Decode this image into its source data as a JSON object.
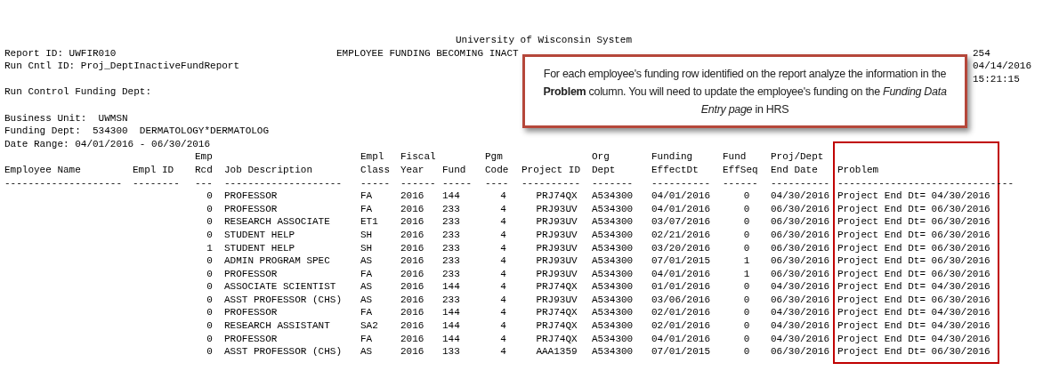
{
  "header": {
    "university": "University of Wisconsin System",
    "report_id": "Report ID: UWFIR010",
    "report_title": "EMPLOYEE FUNDING BECOMING INACT",
    "page_no": "254",
    "run_cntl_id": "Run Cntl ID: Proj_DeptInactiveFundReport",
    "run_date": "04/14/2016",
    "run_time": "15:21:15",
    "run_control_funding_dept": "Run Control Funding Dept:",
    "business_unit": "Business Unit:  UWMSN",
    "funding_dept": "Funding Dept:  534300  DERMATOLOGY*DERMATOLOG",
    "date_range": "Date Range: 04/01/2016 - 06/30/2016"
  },
  "callout": {
    "text": "For each employee's funding row identified on the report analyze the information in the **Problem** column. You will need to update the employee's funding on the *Funding Data Entry page* in HRS"
  },
  "table": {
    "columns": [
      {
        "header": [
          "Employee Name"
        ],
        "rule": "--------------------",
        "highlighted": false
      },
      {
        "header": [
          "Empl ID"
        ],
        "rule": "--------",
        "highlighted": false
      },
      {
        "header": [
          "Emp",
          "Rcd"
        ],
        "rule": "---",
        "highlighted": false
      },
      {
        "header": [
          "Job Description"
        ],
        "rule": "--------------------",
        "highlighted": false
      },
      {
        "header": [
          "Empl",
          "Class"
        ],
        "rule": "-----",
        "highlighted": false
      },
      {
        "header": [
          "Fiscal",
          "Year"
        ],
        "rule": "------",
        "highlighted": false
      },
      {
        "header": [
          "Fund"
        ],
        "rule": "-----",
        "highlighted": false
      },
      {
        "header": [
          "Pgm",
          "Code"
        ],
        "rule": "----",
        "highlighted": false
      },
      {
        "header": [
          "Project ID"
        ],
        "rule": "----------",
        "highlighted": false
      },
      {
        "header": [
          "Org",
          "Dept"
        ],
        "rule": "-------",
        "highlighted": false
      },
      {
        "header": [
          "Funding",
          "EffectDt"
        ],
        "rule": "----------",
        "highlighted": false
      },
      {
        "header": [
          "Fund",
          "EffSeq"
        ],
        "rule": "------",
        "highlighted": false
      },
      {
        "header": [
          "Proj/Dept",
          "End Date"
        ],
        "rule": "----------",
        "highlighted": false
      },
      {
        "header": [
          "Problem"
        ],
        "rule": "------------------------------",
        "highlighted": true
      }
    ],
    "rows": [
      [
        "",
        "",
        "0",
        "PROFESSOR",
        "FA",
        "2016",
        "144",
        "4",
        "PRJ74QX",
        "A534300",
        "04/01/2016",
        "0",
        "04/30/2016",
        "Project End Dt= 04/30/2016"
      ],
      [
        "",
        "",
        "0",
        "PROFESSOR",
        "FA",
        "2016",
        "233",
        "4",
        "PRJ93UV",
        "A534300",
        "04/01/2016",
        "0",
        "06/30/2016",
        "Project End Dt= 06/30/2016"
      ],
      [
        "",
        "",
        "0",
        "RESEARCH ASSOCIATE",
        "ET1",
        "2016",
        "233",
        "4",
        "PRJ93UV",
        "A534300",
        "03/07/2016",
        "0",
        "06/30/2016",
        "Project End Dt= 06/30/2016"
      ],
      [
        "",
        "",
        "0",
        "STUDENT HELP",
        "SH",
        "2016",
        "233",
        "4",
        "PRJ93UV",
        "A534300",
        "02/21/2016",
        "0",
        "06/30/2016",
        "Project End Dt= 06/30/2016"
      ],
      [
        "",
        "",
        "1",
        "STUDENT HELP",
        "SH",
        "2016",
        "233",
        "4",
        "PRJ93UV",
        "A534300",
        "03/20/2016",
        "0",
        "06/30/2016",
        "Project End Dt= 06/30/2016"
      ],
      [
        "",
        "",
        "0",
        "ADMIN PROGRAM SPEC",
        "AS",
        "2016",
        "233",
        "4",
        "PRJ93UV",
        "A534300",
        "07/01/2015",
        "1",
        "06/30/2016",
        "Project End Dt= 06/30/2016"
      ],
      [
        "",
        "",
        "0",
        "PROFESSOR",
        "FA",
        "2016",
        "233",
        "4",
        "PRJ93UV",
        "A534300",
        "04/01/2016",
        "1",
        "06/30/2016",
        "Project End Dt= 06/30/2016"
      ],
      [
        "",
        "",
        "0",
        "ASSOCIATE SCIENTIST",
        "AS",
        "2016",
        "144",
        "4",
        "PRJ74QX",
        "A534300",
        "01/01/2016",
        "0",
        "04/30/2016",
        "Project End Dt= 04/30/2016"
      ],
      [
        "",
        "",
        "0",
        "ASST PROFESSOR (CHS)",
        "AS",
        "2016",
        "233",
        "4",
        "PRJ93UV",
        "A534300",
        "03/06/2016",
        "0",
        "06/30/2016",
        "Project End Dt= 06/30/2016"
      ],
      [
        "",
        "",
        "0",
        "PROFESSOR",
        "FA",
        "2016",
        "144",
        "4",
        "PRJ74QX",
        "A534300",
        "02/01/2016",
        "0",
        "04/30/2016",
        "Project End Dt= 04/30/2016"
      ],
      [
        "",
        "",
        "0",
        "RESEARCH ASSISTANT",
        "SA2",
        "2016",
        "144",
        "4",
        "PRJ74QX",
        "A534300",
        "02/01/2016",
        "0",
        "04/30/2016",
        "Project End Dt= 04/30/2016"
      ],
      [
        "",
        "",
        "0",
        "PROFESSOR",
        "FA",
        "2016",
        "144",
        "4",
        "PRJ74QX",
        "A534300",
        "04/01/2016",
        "0",
        "04/30/2016",
        "Project End Dt= 04/30/2016"
      ],
      [
        "",
        "",
        "0",
        "ASST PROFESSOR (CHS)",
        "AS",
        "2016",
        "133",
        "4",
        "AAA1359",
        "A534300",
        "07/01/2015",
        "0",
        "06/30/2016",
        "Project End Dt= 06/30/2016"
      ]
    ]
  }
}
